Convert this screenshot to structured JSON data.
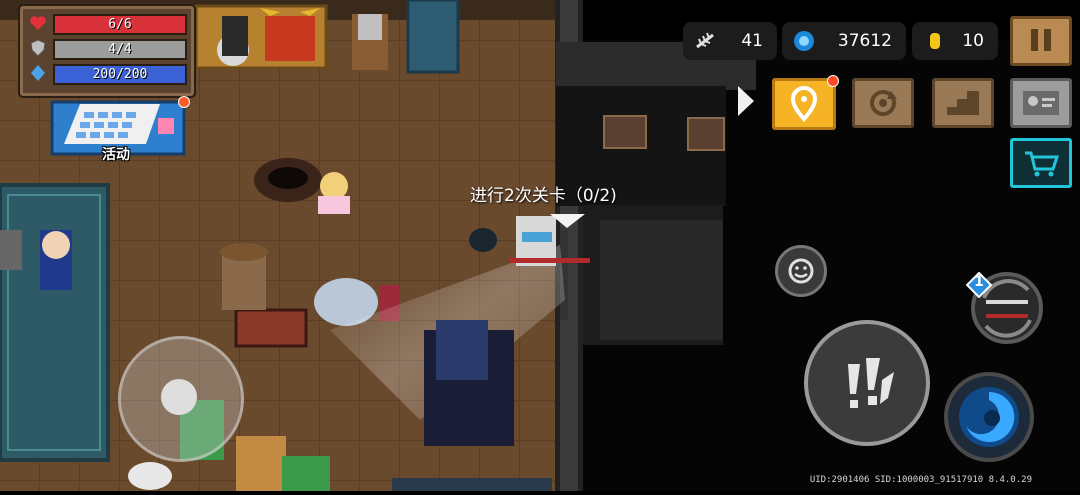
{
  "stats": {
    "hp": {
      "text": "6/6",
      "fraction": 1.0,
      "color": "#d8313a"
    },
    "armor": {
      "text": "4/4",
      "fraction": 1.0,
      "color": "#9c9c9c"
    },
    "energy": {
      "text": "200/200",
      "fraction": 1.0,
      "color": "#3a62d6"
    }
  },
  "activity": {
    "label": "活动",
    "has_notification": true
  },
  "currencies": {
    "materials": {
      "icon": "fish-bone-icon",
      "value": "41"
    },
    "gems": {
      "icon": "gem-icon",
      "value": "37612"
    },
    "coins": {
      "icon": "coin-icon",
      "value": "10"
    }
  },
  "top_buttons": [
    "pause-button",
    "expand-arrow",
    "location-button",
    "refresh-button",
    "stairs-button",
    "id-card-button",
    "shop-button"
  ],
  "quest": {
    "text": "进行2次关卡（0/2)"
  },
  "weapon_swap": {
    "badge": "1"
  },
  "footer": {
    "uid": "UID:2901406 SID:1000003_91517910 8.4.0.29"
  },
  "colors": {
    "accent_yellow": "#f5b325",
    "floor": "#6b4a2e",
    "shop_cyan": "#21c7d9"
  }
}
